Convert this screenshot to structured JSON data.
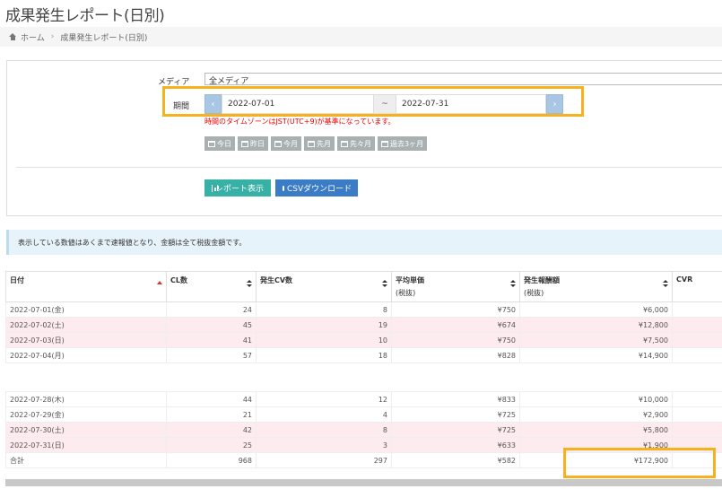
{
  "page": {
    "title": "成果発生レポート(日別)"
  },
  "breadcrumb": {
    "home": "ホーム",
    "separator": "›",
    "current": "成果発生レポート(日別)"
  },
  "filters": {
    "media_label": "メディア",
    "media_value": "全メディア",
    "period_label": "期間",
    "prev_arrow": "‹",
    "next_arrow": "›",
    "start_date": "2022-07-01",
    "range_separator": "~",
    "end_date": "2022-07-31",
    "timezone_note": "時間のタイムゾーンはJST(UTC+9)が基準になっています。",
    "quick_ranges": [
      "今日",
      "昨日",
      "今月",
      "先月",
      "先々月",
      "過去3ヶ月"
    ]
  },
  "actions": {
    "report_button": "レポート表示",
    "csv_button": "CSVダウンロード"
  },
  "info_message": "表示している数値はあくまで速報値となり、金額は全て税抜金額です。",
  "table": {
    "columns": [
      {
        "label": "日付",
        "sub": ""
      },
      {
        "label": "CL数",
        "sub": ""
      },
      {
        "label": "発生CV数",
        "sub": ""
      },
      {
        "label": "平均単価",
        "sub": "(税抜)"
      },
      {
        "label": "発生報酬額",
        "sub": "(税抜)"
      },
      {
        "label": "CVR",
        "sub": ""
      }
    ],
    "rows_top": [
      {
        "date": "2022-07-01(金)",
        "cl": "24",
        "cv": "8",
        "avg": "¥750",
        "reward": "¥6,000",
        "cvr": "",
        "pink": false
      },
      {
        "date": "2022-07-02(土)",
        "cl": "45",
        "cv": "19",
        "avg": "¥674",
        "reward": "¥12,800",
        "cvr": "",
        "pink": true
      },
      {
        "date": "2022-07-03(日)",
        "cl": "41",
        "cv": "10",
        "avg": "¥750",
        "reward": "¥7,500",
        "cvr": "",
        "pink": true
      },
      {
        "date": "2022-07-04(月)",
        "cl": "57",
        "cv": "18",
        "avg": "¥828",
        "reward": "¥14,900",
        "cvr": "",
        "pink": false
      }
    ],
    "rows_bottom": [
      {
        "date": "2022-07-28(木)",
        "cl": "44",
        "cv": "12",
        "avg": "¥833",
        "reward": "¥10,000",
        "cvr": "",
        "pink": false
      },
      {
        "date": "2022-07-29(金)",
        "cl": "21",
        "cv": "4",
        "avg": "¥725",
        "reward": "¥2,900",
        "cvr": "",
        "pink": false
      },
      {
        "date": "2022-07-30(土)",
        "cl": "42",
        "cv": "8",
        "avg": "¥725",
        "reward": "¥5,800",
        "cvr": "",
        "pink": true
      },
      {
        "date": "2022-07-31(日)",
        "cl": "25",
        "cv": "3",
        "avg": "¥633",
        "reward": "¥1,900",
        "cvr": "",
        "pink": true
      }
    ],
    "total": {
      "label": "合計",
      "cl": "968",
      "cv": "297",
      "avg": "¥582",
      "reward": "¥172,900",
      "cvr": ""
    }
  },
  "colors": {
    "highlight": "#f5b21e",
    "report_button": "#37b0a5",
    "csv_button": "#3a7cc6",
    "pink_row": "#fdebef",
    "note_red": "#e00000"
  }
}
